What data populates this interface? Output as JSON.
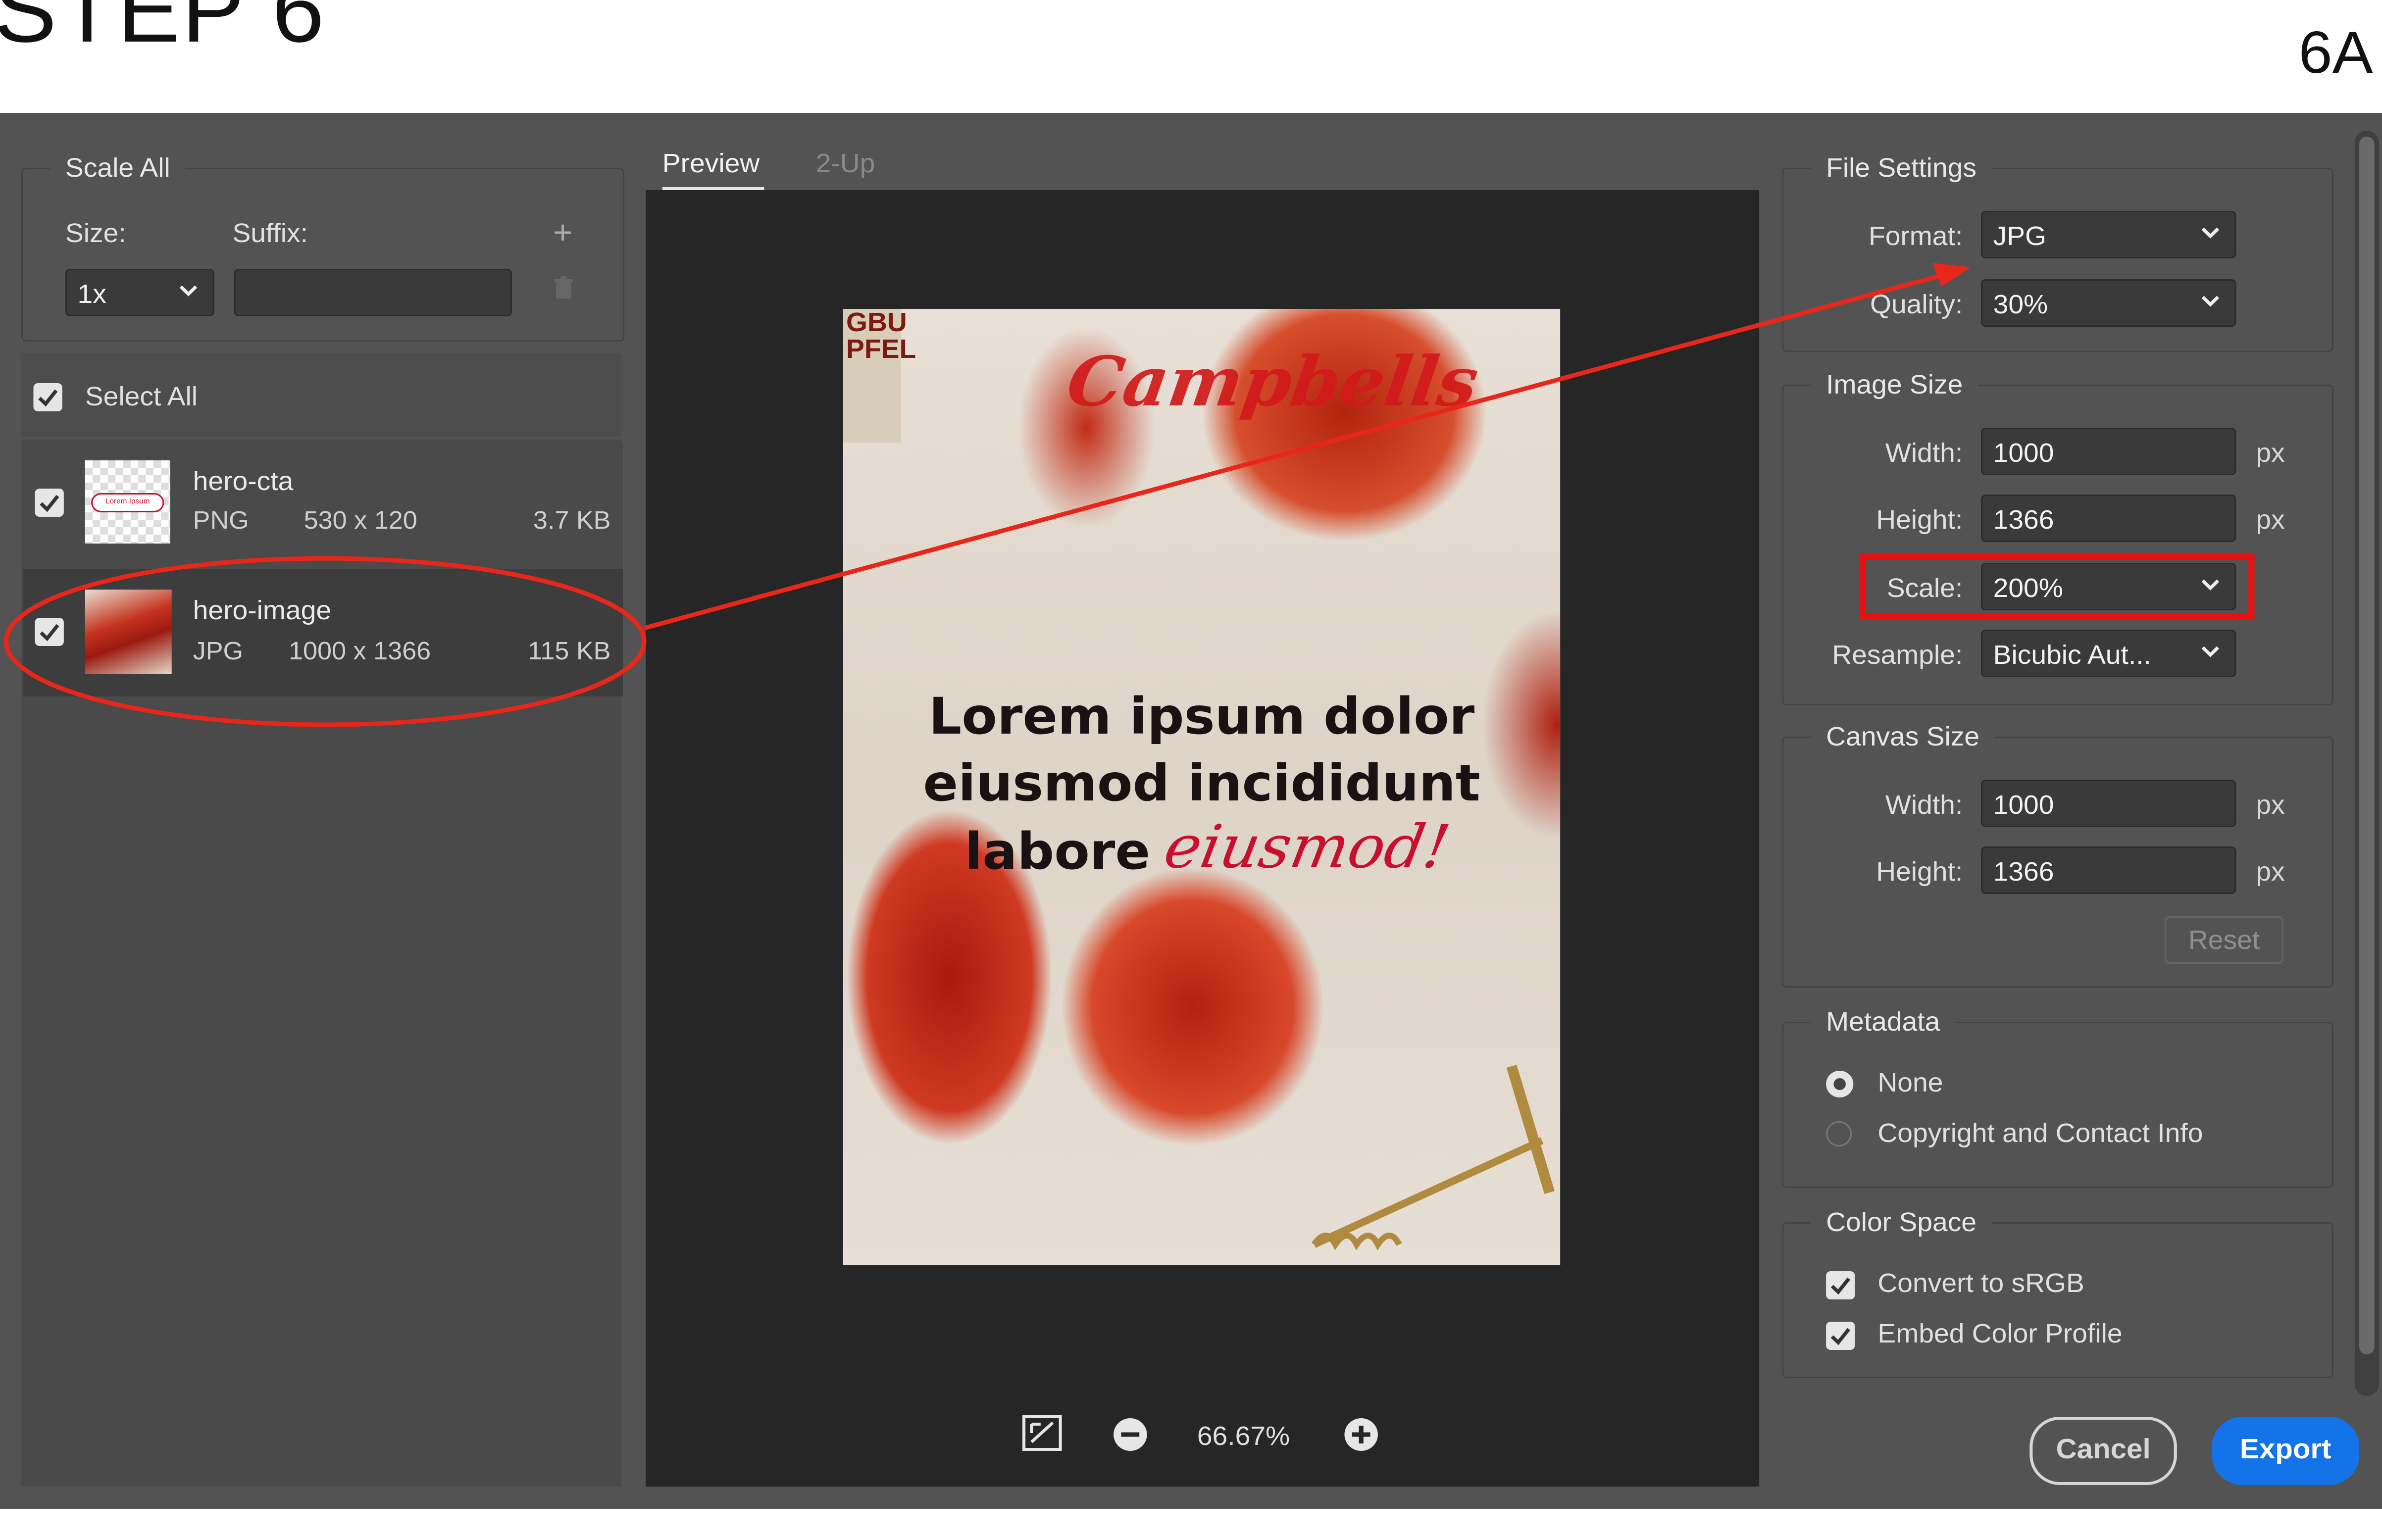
{
  "header": {
    "step_title": "STEP 6",
    "step_code": "6A"
  },
  "left_panel": {
    "scale_all": {
      "legend": "Scale All",
      "size_label": "Size:",
      "suffix_label": "Suffix:",
      "size_value": "1x",
      "suffix_value": ""
    },
    "select_all_label": "Select All",
    "assets": [
      {
        "name": "hero-cta",
        "format": "PNG",
        "dimensions": "530 x 120",
        "size": "3.7 KB",
        "checked": true,
        "thumb_text": "Lorem Ipsum"
      },
      {
        "name": "hero-image",
        "format": "JPG",
        "dimensions": "1000 x 1366",
        "size": "115 KB",
        "checked": true,
        "selected": true
      }
    ]
  },
  "preview": {
    "tabs": [
      {
        "label": "Preview",
        "active": true
      },
      {
        "label": "2-Up",
        "active": false
      }
    ],
    "image": {
      "brand": "Campbells",
      "headline_lines": [
        "Lorem ipsum dolor",
        "eiusmod incididunt",
        "labore"
      ],
      "script_text": "eiusmod!",
      "side_label": "GBU\nPFEL"
    },
    "zoom": "66.67%"
  },
  "file_settings": {
    "legend": "File Settings",
    "format_label": "Format:",
    "format_value": "JPG",
    "quality_label": "Quality:",
    "quality_value": "30%"
  },
  "image_size": {
    "legend": "Image Size",
    "width_label": "Width:",
    "width_value": "1000",
    "height_label": "Height:",
    "height_value": "1366",
    "scale_label": "Scale:",
    "scale_value": "200%",
    "resample_label": "Resample:",
    "resample_value": "Bicubic Aut...",
    "unit": "px"
  },
  "canvas_size": {
    "legend": "Canvas Size",
    "width_label": "Width:",
    "width_value": "1000",
    "height_label": "Height:",
    "height_value": "1366",
    "unit": "px",
    "reset_label": "Reset"
  },
  "metadata": {
    "legend": "Metadata",
    "options": [
      "None",
      "Copyright and Contact Info"
    ],
    "selected": "None"
  },
  "color_space": {
    "legend": "Color Space",
    "convert_label": "Convert to sRGB",
    "embed_label": "Embed Color Profile",
    "convert_checked": true,
    "embed_checked": true
  },
  "actions": {
    "cancel_label": "Cancel",
    "export_label": "Export"
  },
  "colors": {
    "annotation_red": "#e8271a",
    "export_blue": "#1473e6",
    "dialog_bg": "#535353"
  }
}
